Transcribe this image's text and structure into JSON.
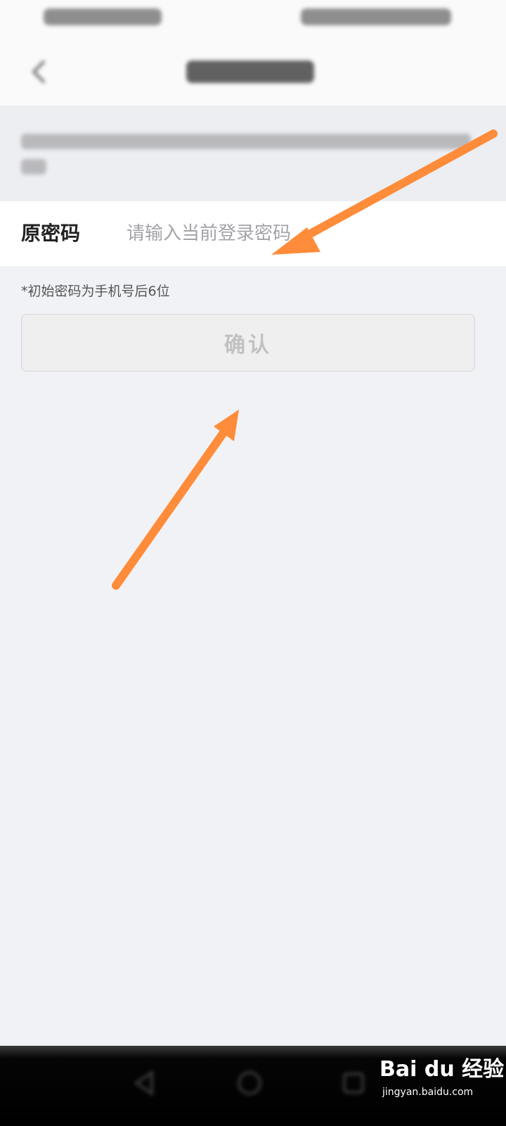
{
  "form": {
    "field_label": "原密码",
    "input_placeholder": "请输入当前登录密码",
    "input_value": "",
    "hint": "*初始密码为手机号后6位",
    "confirm_label": "确认"
  },
  "watermark": {
    "main": "Bai du 经验",
    "sub": "jingyan.baidu.com"
  },
  "colors": {
    "page_background": "#f1f2f6",
    "annotation_arrow": "#ff8c3a",
    "button_disabled_text": "#c1c1c1"
  },
  "icons": {
    "back": "back-arrow-icon",
    "nav_back": "triangle-back-icon",
    "nav_home": "circle-home-icon",
    "nav_recent": "square-recent-icon"
  }
}
